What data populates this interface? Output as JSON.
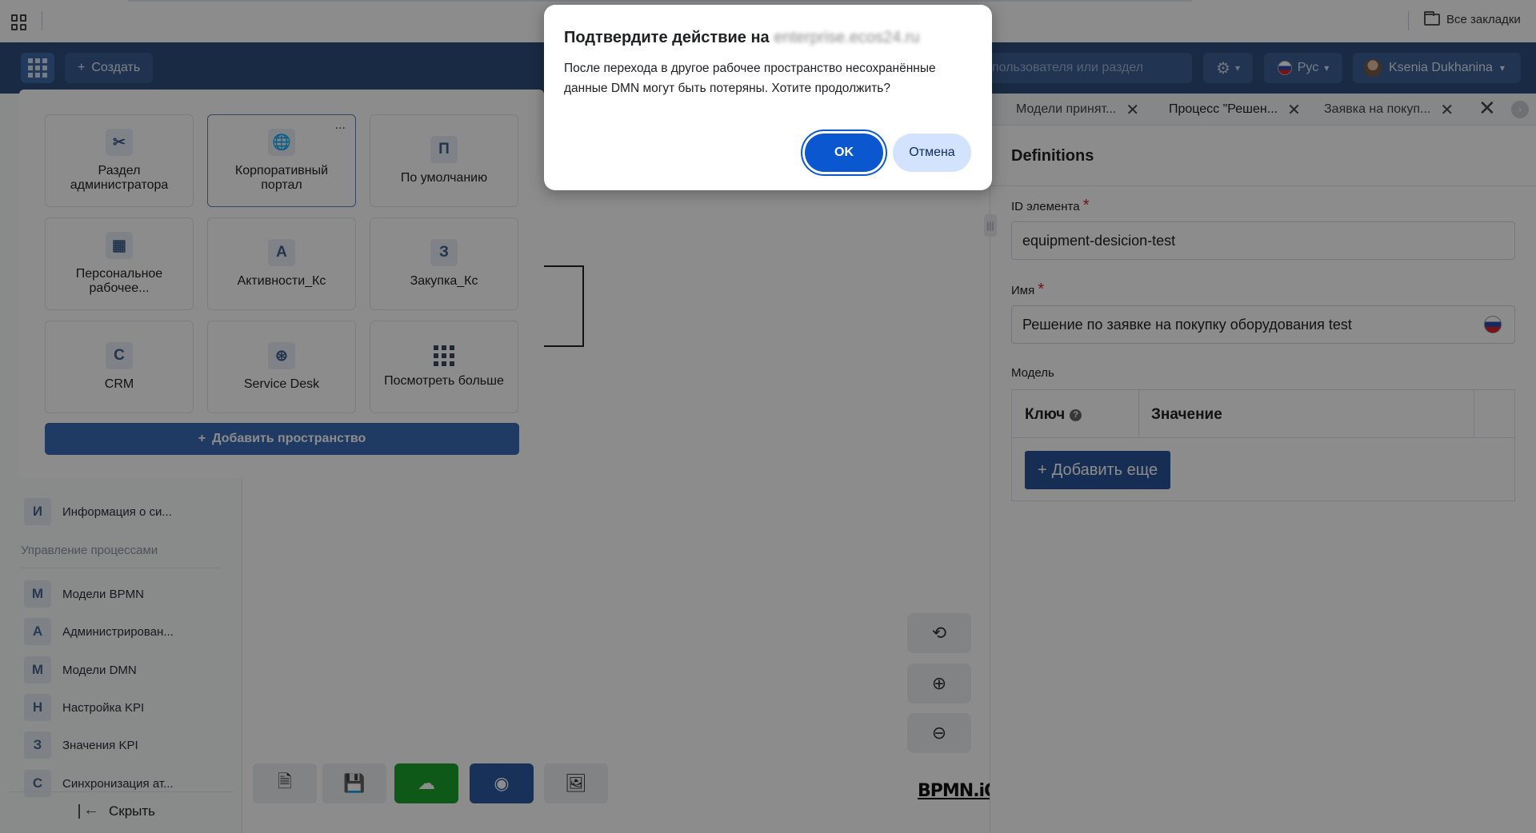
{
  "browser": {
    "all_bookmarks_label": "Все закладки"
  },
  "header": {
    "create_label": "Создать",
    "search_placeholder": "пользователя или раздел",
    "language_label": "Рус",
    "user_name": "Ksenia Dukhanina"
  },
  "sidebar": {
    "items_top": [
      {
        "letter": "И",
        "label": "Информация о си..."
      }
    ],
    "section_title": "Управление процессами",
    "items": [
      {
        "letter": "М",
        "label": "Модели BPMN"
      },
      {
        "letter": "А",
        "label": "Администрирован..."
      },
      {
        "letter": "М",
        "label": "Модели DMN"
      },
      {
        "letter": "Н",
        "label": "Настройка KPI"
      },
      {
        "letter": "З",
        "label": "Значения KPI"
      },
      {
        "letter": "С",
        "label": "Синхронизация ат..."
      }
    ],
    "hide_label": "Скрыть"
  },
  "workspaces": {
    "cards": [
      {
        "icon": "tools-icon",
        "label": "Раздел администратора"
      },
      {
        "icon": "globe-icon",
        "label": "Корпоративный портал",
        "more": "..."
      },
      {
        "icon_letter": "П",
        "label": "По умолчанию"
      },
      {
        "icon": "store-icon",
        "label": "Персональное рабочее..."
      },
      {
        "icon_letter": "А",
        "label": "Активности_Кс"
      },
      {
        "icon_letter": "З",
        "label": "Закупка_Кс"
      },
      {
        "icon_letter": "С",
        "label": "CRM"
      },
      {
        "icon": "lifebuoy-icon",
        "label": "Service Desk"
      },
      {
        "icon": "grid-icon",
        "label": "Посмотреть больше"
      }
    ],
    "add_label": "Добавить пространство"
  },
  "canvas": {
    "logo": "BPMN.iO"
  },
  "tabs": [
    {
      "label": "Модели принят..."
    },
    {
      "label": "Процесс \"Решен..."
    },
    {
      "label": "Заявка на покуп..."
    }
  ],
  "properties": {
    "title": "Definitions",
    "id_label": "ID элемента",
    "id_value": "equipment-desicion-test",
    "name_label": "Имя",
    "name_value": "Решение по заявке на покупку оборудования test",
    "model_label": "Модель",
    "key_header": "Ключ",
    "value_header": "Значение",
    "add_more_label": "Добавить еще"
  },
  "dialog": {
    "title_prefix": "Подтвердите действие на",
    "domain": "enterprise.ecos24.ru",
    "body": "После перехода в другое рабочее пространство несохранённые данные DMN могут быть потеряны. Хотите продолжить?",
    "ok_label": "OK",
    "cancel_label": "Отмена"
  },
  "colors": {
    "header_bg": "#2f4d7c",
    "primary": "#0b57d0",
    "add_button": "#2b5599",
    "upload_green": "#1aa32c"
  }
}
